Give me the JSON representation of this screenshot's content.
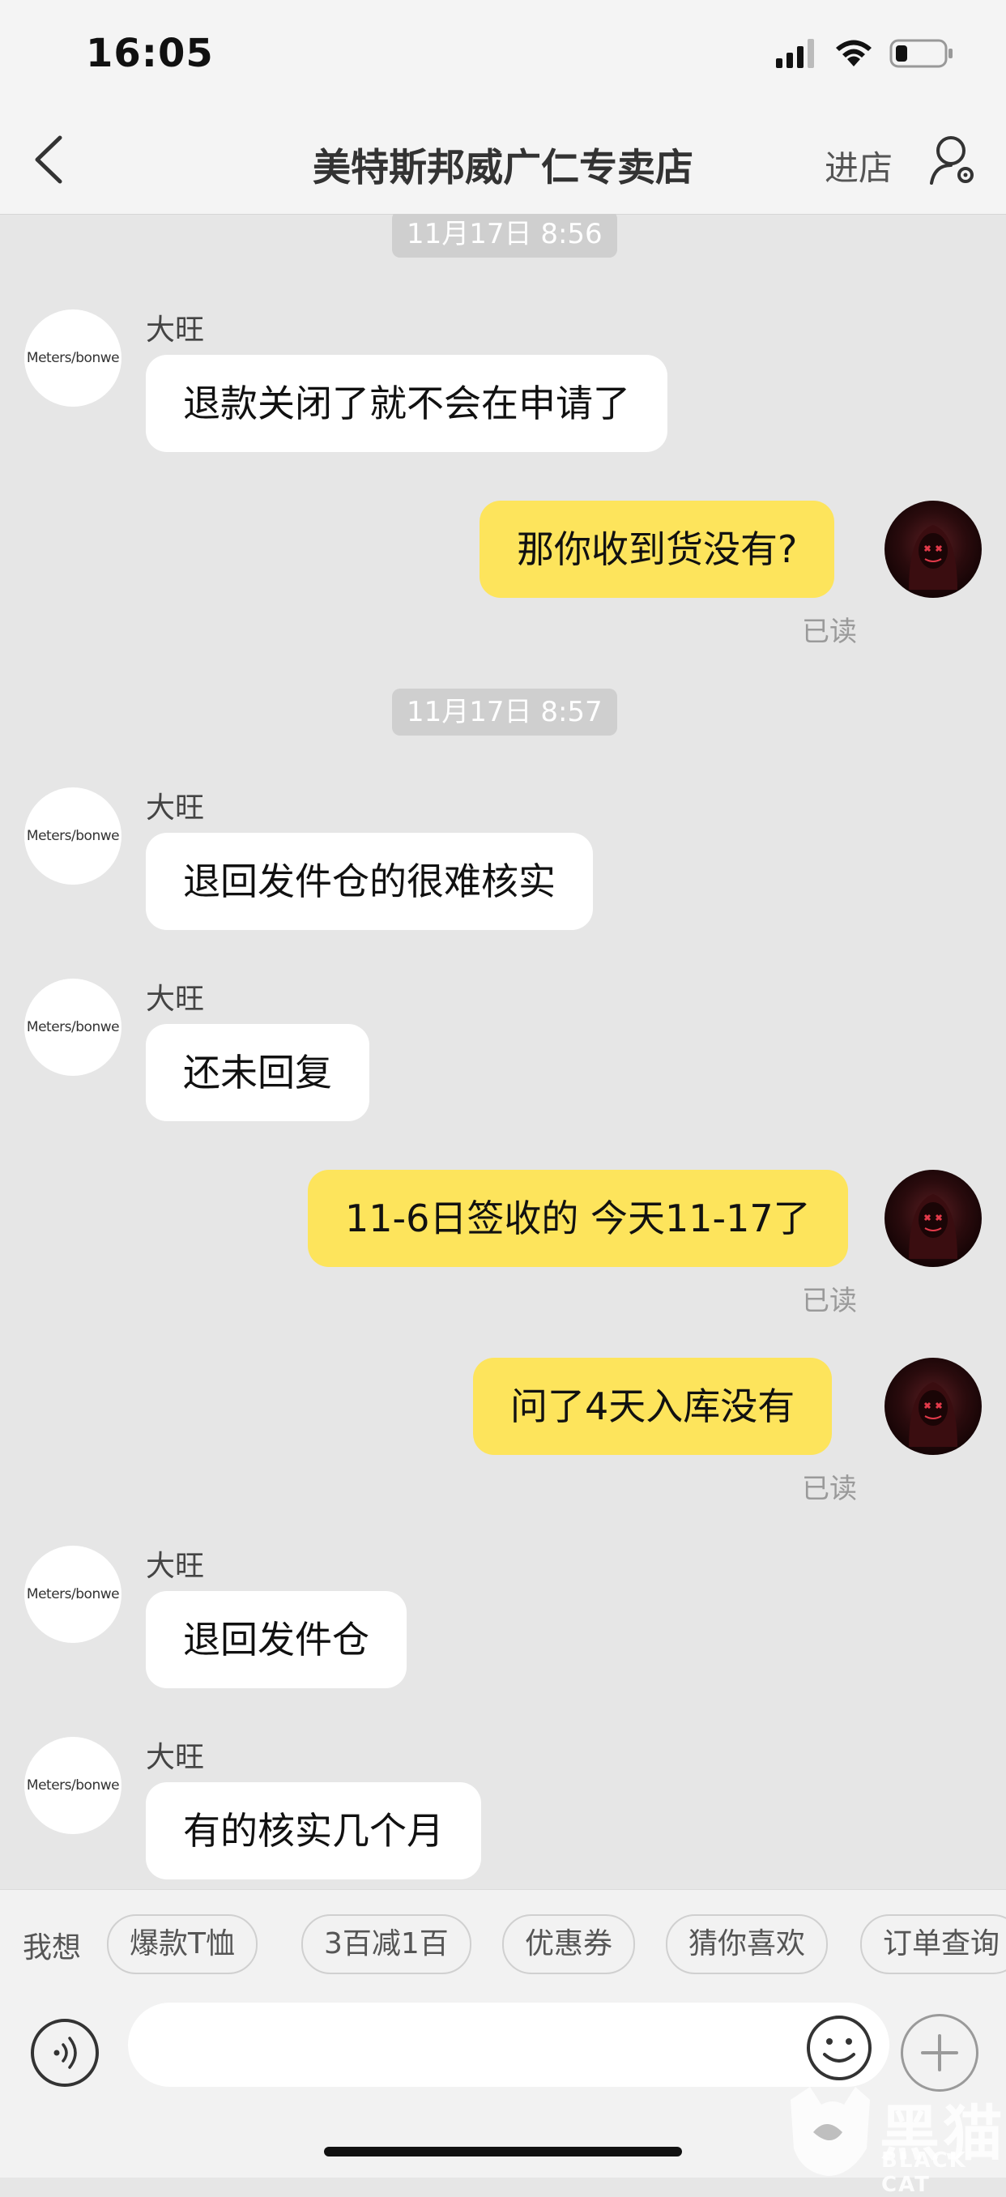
{
  "status_bar": {
    "time": "16:05"
  },
  "nav": {
    "title": "美特斯邦威广仁专卖店",
    "enter_store": "进店"
  },
  "shop_avatar_text": "Meters/bonwe",
  "messages": [
    {
      "type": "timestamp",
      "text": "11月17日 8:56"
    },
    {
      "type": "incoming",
      "sender": "大旺",
      "text": "退款关闭了就不会在申请了"
    },
    {
      "type": "outgoing",
      "text": "那你收到货没有?",
      "status": "已读"
    },
    {
      "type": "timestamp",
      "text": "11月17日 8:57"
    },
    {
      "type": "incoming",
      "sender": "大旺",
      "text": "退回发件仓的很难核实"
    },
    {
      "type": "incoming",
      "sender": "大旺",
      "text": "还未回复"
    },
    {
      "type": "outgoing",
      "text": "11-6日签收的  今天11-17了",
      "status": "已读"
    },
    {
      "type": "outgoing",
      "text": "问了4天入库没有",
      "status": "已读"
    },
    {
      "type": "incoming",
      "sender": "大旺",
      "text": "退回发件仓"
    },
    {
      "type": "incoming",
      "sender": "大旺",
      "text": "有的核实几个月"
    }
  ],
  "suggestions": {
    "label": "我想",
    "chips": [
      "爆款T恤",
      "3百减1百",
      "优惠券",
      "猜你喜欢",
      "订单查询"
    ]
  },
  "input": {
    "placeholder": ""
  },
  "watermark": {
    "text": "黑猫",
    "sub": "BLACK CAT"
  },
  "colors": {
    "outgoing_bubble": "#fde45c",
    "incoming_bubble": "#ffffff",
    "chat_background": "#e6e6e6"
  }
}
